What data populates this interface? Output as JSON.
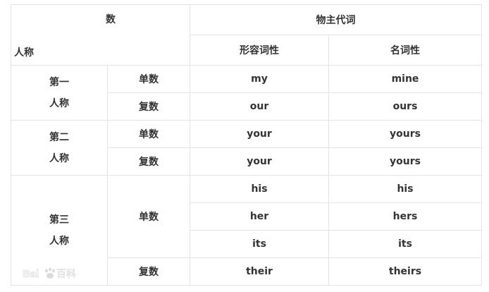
{
  "header": {
    "number_label": "数",
    "person_label": "人称",
    "possessive_label": "物主代词",
    "adjectival_label": "形容词性",
    "nominal_label": "名词性"
  },
  "rows": [
    {
      "person_line1": "第一",
      "person_line2": "人称",
      "number": "单数",
      "adjectival": "my",
      "nominal": "mine"
    },
    {
      "number": "复数",
      "adjectival": "our",
      "nominal": "ours"
    },
    {
      "person_line1": "第二",
      "person_line2": "人称",
      "number": "单数",
      "adjectival": "your",
      "nominal": "yours"
    },
    {
      "number": "复数",
      "adjectival": "your",
      "nominal": "yours"
    },
    {
      "person_line1": "第三",
      "person_line2": "人称",
      "number": "单数",
      "adjectival": "his",
      "nominal": "his"
    },
    {
      "adjectival": "her",
      "nominal": "hers"
    },
    {
      "adjectival": "its",
      "nominal": "its"
    },
    {
      "number": "复数",
      "adjectival": "their",
      "nominal": "theirs"
    }
  ],
  "watermark": {
    "text": "Bai百科"
  }
}
